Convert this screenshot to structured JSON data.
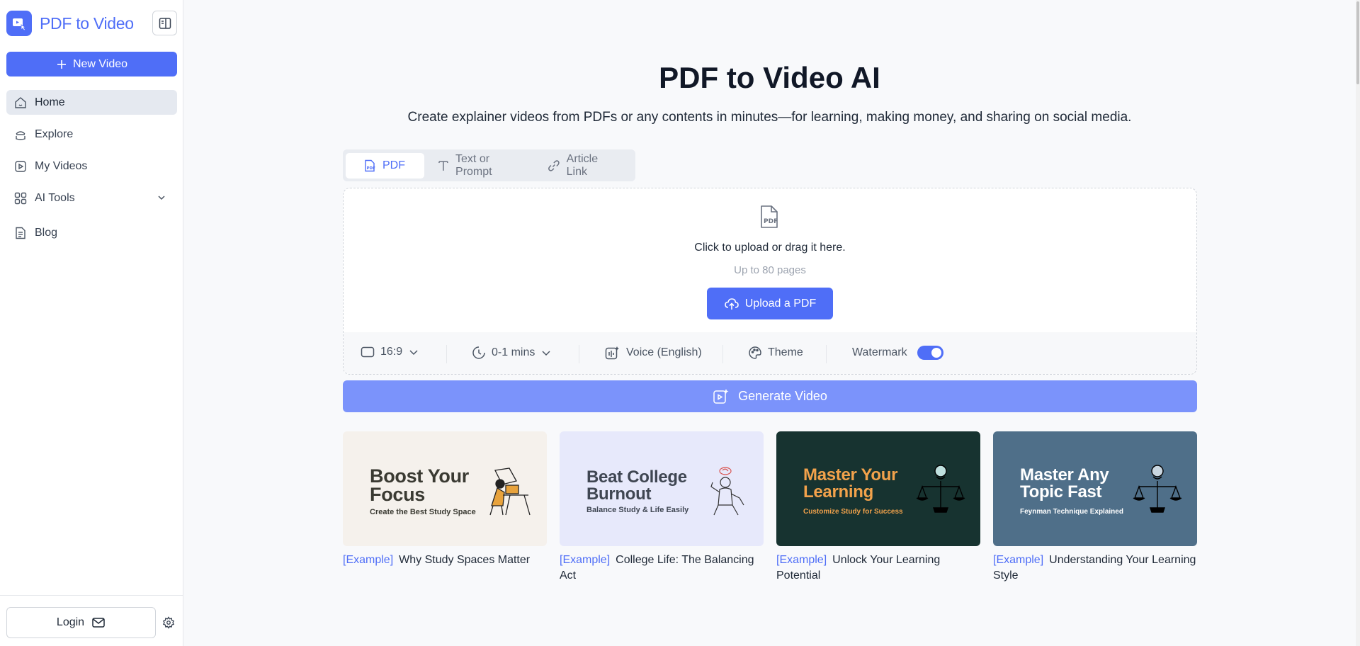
{
  "brand": {
    "name": "PDF to Video",
    "accent": "#4f6ef7"
  },
  "sidebar": {
    "new_video_label": "New Video",
    "items": [
      {
        "label": "Home",
        "icon": "home-icon",
        "active": true
      },
      {
        "label": "Explore",
        "icon": "explore-icon"
      },
      {
        "label": "My Videos",
        "icon": "video-icon"
      },
      {
        "label": "AI Tools",
        "icon": "grid-icon",
        "expandable": true
      },
      {
        "label": "Blog",
        "icon": "document-icon"
      }
    ],
    "login_label": "Login"
  },
  "main": {
    "title": "PDF to Video AI",
    "subtitle": "Create explainer videos from PDFs or any contents in minutes—for learning, making money, and sharing on social media.",
    "tabs": [
      {
        "label": "PDF",
        "icon": "pdf-icon",
        "active": true
      },
      {
        "label": "Text or Prompt",
        "icon": "text-icon"
      },
      {
        "label": "Article Link",
        "icon": "link-icon"
      }
    ],
    "upload": {
      "instruction": "Click to upload or drag it here.",
      "limit": "Up to 80 pages",
      "button_label": "Upload a PDF"
    },
    "options": {
      "aspect_ratio": "16:9",
      "duration": "0-1 mins",
      "voice": "Voice (English)",
      "theme": "Theme",
      "watermark_label": "Watermark",
      "watermark_on": true
    },
    "generate_label": "Generate Video",
    "examples": [
      {
        "tag": "[Example]",
        "caption": "Why Study Spaces Matter",
        "thumb_title_1": "Boost Your",
        "thumb_title_2": "Focus",
        "thumb_sub": "Create the Best Study Space",
        "bg": "#f5f1ec",
        "title_color": "#3a3a32",
        "sub_color": "#3a3a32"
      },
      {
        "tag": "[Example]",
        "caption": "College Life: The Balancing Act",
        "thumb_title_1": "Beat College",
        "thumb_title_2": "Burnout",
        "thumb_sub": "Balance Study & Life Easily",
        "bg": "#e7e9fb",
        "title_color": "#3f4652",
        "sub_color": "#3f4652"
      },
      {
        "tag": "[Example]",
        "caption": "Unlock Your Learning Potential",
        "thumb_title_1": "Master Your",
        "thumb_title_2": "Learning",
        "thumb_sub": "Customize Study for Success",
        "bg": "#173330",
        "title_color": "#f2a24b",
        "sub_color": "#f2a24b"
      },
      {
        "tag": "[Example]",
        "caption": "Understanding Your Learning Style",
        "thumb_title_1": "Master Any",
        "thumb_title_2": "Topic Fast",
        "thumb_sub": "Feynman Technique Explained",
        "bg": "#4f6f89",
        "title_color": "#ffffff",
        "sub_color": "#ffffff"
      }
    ]
  }
}
